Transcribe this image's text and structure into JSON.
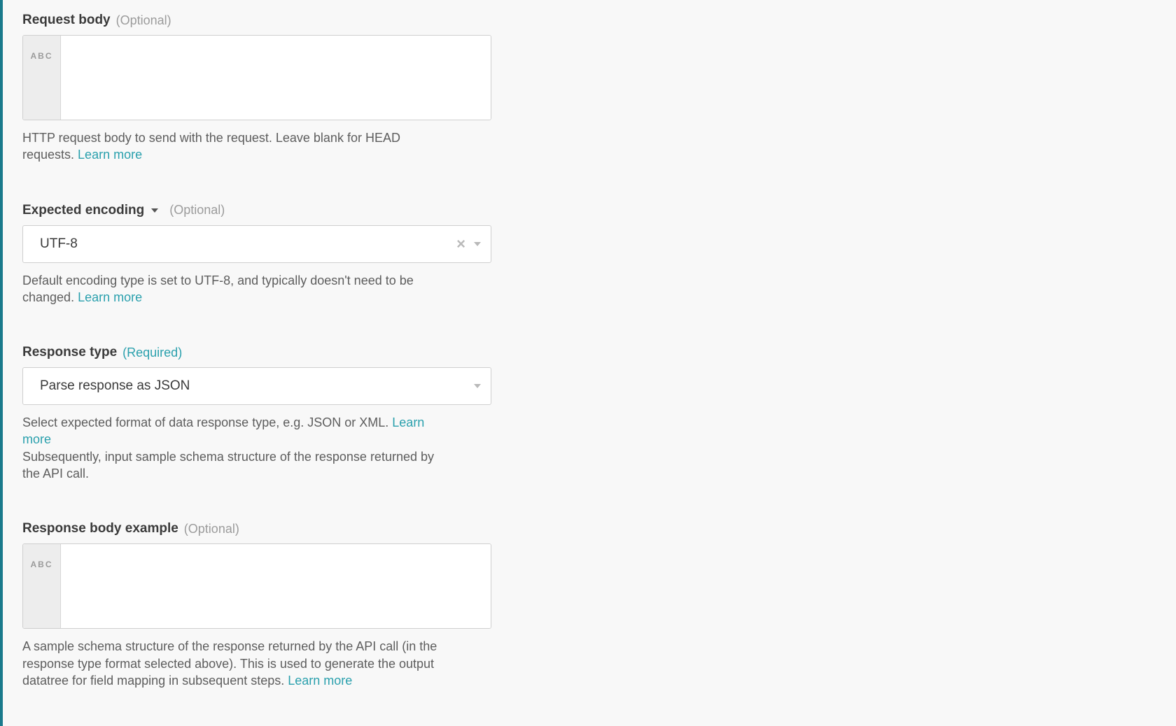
{
  "fields": {
    "request_body": {
      "label": "Request body",
      "optional_text": "(Optional)",
      "input_hint": "ABC",
      "value": "",
      "help": "HTTP request body to send with the request. Leave blank for HEAD requests. ",
      "link": "Learn more"
    },
    "expected_encoding": {
      "label": "Expected encoding",
      "optional_text": "(Optional)",
      "value": "UTF-8",
      "help": "Default encoding type is set to UTF-8, and typically doesn't need to be changed. ",
      "link": "Learn more"
    },
    "response_type": {
      "label": "Response type",
      "required_text": "(Required)",
      "value": "Parse response as JSON",
      "help1": "Select expected format of data response type, e.g. JSON or XML. ",
      "link": "Learn more",
      "help2": "Subsequently, input sample schema structure of the response returned by the API call."
    },
    "response_body_example": {
      "label": "Response body example",
      "optional_text": "(Optional)",
      "input_hint": "ABC",
      "value": "",
      "help": "A sample schema structure of the response returned by the API call (in the response type format selected above). This is used to generate the output datatree for field mapping in subsequent steps. ",
      "link": "Learn more"
    }
  }
}
